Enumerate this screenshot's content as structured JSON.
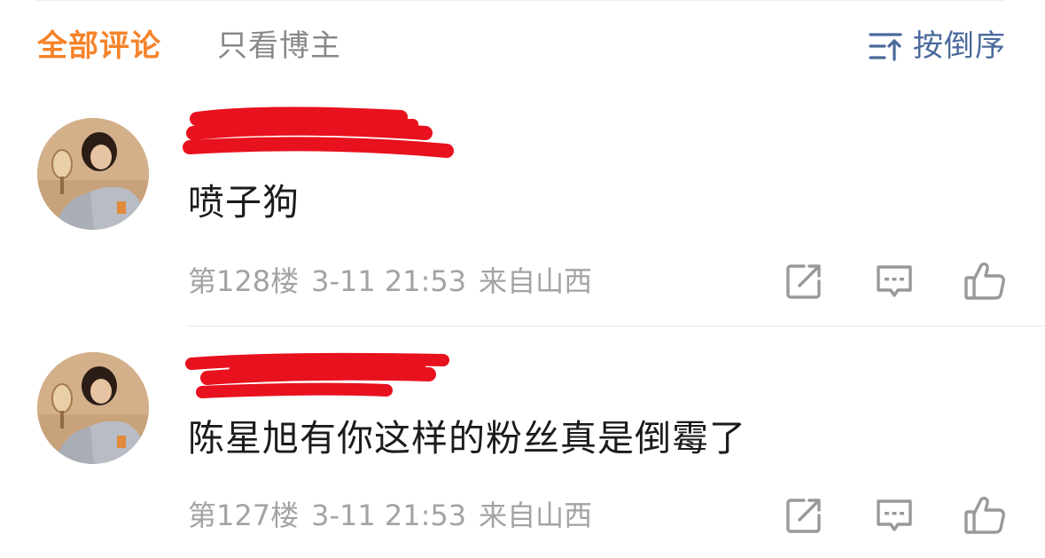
{
  "tabs": {
    "all_comments": "全部评论",
    "blogger_only": "只看博主"
  },
  "sort": {
    "label": "按倒序",
    "icon": "sort-order-icon"
  },
  "comments": [
    {
      "username": "",
      "text": "喷子狗",
      "floor": "第128楼",
      "time": "3-11 21:53",
      "location": "来自山西"
    },
    {
      "username": "",
      "text": "陈星旭有你这样的粉丝真是倒霉了",
      "floor": "第127楼",
      "time": "3-11 21:53",
      "location": "来自山西"
    }
  ],
  "colors": {
    "accent": "#f5832a",
    "link": "#4b6a9b",
    "muted": "#a3a3a3",
    "redaction": "#e8111e"
  }
}
